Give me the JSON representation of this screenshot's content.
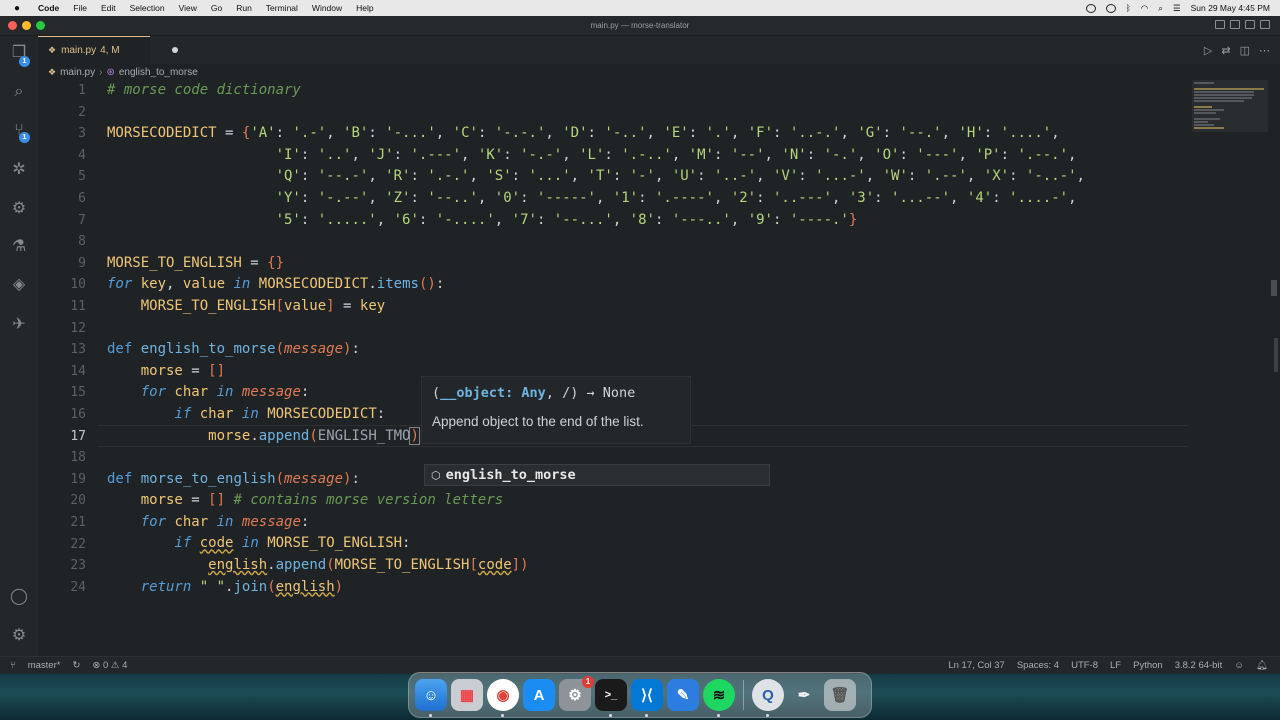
{
  "menubar": {
    "app": "Code",
    "items": [
      "File",
      "Edit",
      "Selection",
      "View",
      "Go",
      "Run",
      "Terminal",
      "Window",
      "Help"
    ],
    "clock": "Sun 29 May  4:45 PM"
  },
  "window": {
    "title": "main.py — morse-translator"
  },
  "tab": {
    "filename": "main.py",
    "status": "4, M"
  },
  "breadcrumb": {
    "file": "main.py",
    "symbol": "english_to_morse"
  },
  "activity": {
    "explorer_badge": "1",
    "scm_badge": "1"
  },
  "editor": {
    "current_line": "17",
    "line_numbers": [
      "1",
      "2",
      "3",
      "4",
      "5",
      "6",
      "7",
      "8",
      "9",
      "10",
      "11",
      "12",
      "13",
      "14",
      "15",
      "16",
      "17",
      "18",
      "19",
      "20",
      "21",
      "22",
      "23",
      "24"
    ]
  },
  "hover": {
    "signature_open": "(",
    "param": "__object: Any",
    "signature_rest": ", /) → None",
    "doc": "Append object to the end of the list."
  },
  "suggest": {
    "item": "english_to_morse"
  },
  "statusbar": {
    "branch": "master*",
    "problems": "⊗ 0 ⚠ 4",
    "position": "Ln 17, Col 37",
    "spaces": "Spaces: 4",
    "encoding": "UTF-8",
    "eol": "LF",
    "language": "Python",
    "interpreter": "3.8.2 64-bit"
  },
  "dock": {
    "settings_badge": "1",
    "apps": [
      "finder-icon",
      "launchpad-icon",
      "chrome-icon",
      "app-store-icon",
      "system-preferences-icon",
      "terminal-icon",
      "vscode-icon",
      "xcode-icon",
      "spotify-icon",
      "quicktime-icon",
      "pen-icon",
      "trash-icon"
    ]
  },
  "colors": {
    "keyword": "#569cd6",
    "variable": "#f0c674",
    "string": "#b5d67b",
    "comment": "#6a9955",
    "function": "#6fb3e0"
  }
}
